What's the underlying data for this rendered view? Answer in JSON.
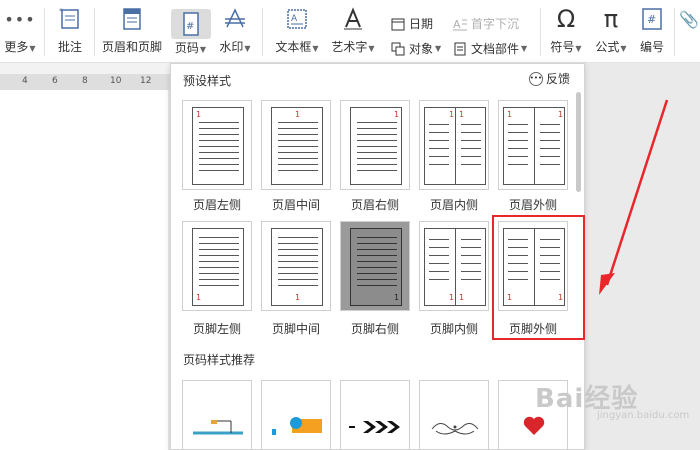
{
  "ribbon": {
    "more": "更多",
    "comment": "批注",
    "header_footer": "页眉和页脚",
    "page_number": "页码",
    "watermark": "水印",
    "textbox": "文本框",
    "wordart": "艺术字",
    "date": "日期",
    "object": "对象",
    "drop_cap": "首字下沉",
    "doc_parts": "文档部件",
    "symbol": "符号",
    "formula": "公式",
    "numbering": "编号"
  },
  "ruler": {
    "ticks": [
      "4",
      "6",
      "8",
      "10",
      "12"
    ]
  },
  "panel": {
    "title": "预设样式",
    "feedback": "反馈",
    "presets_row1": [
      {
        "label": "页眉左侧",
        "number": "1"
      },
      {
        "label": "页眉中间",
        "number": "1"
      },
      {
        "label": "页眉右侧",
        "number": "1"
      },
      {
        "label": "页眉内侧",
        "number": "1"
      },
      {
        "label": "页眉外侧",
        "number": "1"
      }
    ],
    "presets_row2": [
      {
        "label": "页脚左侧",
        "number": "1"
      },
      {
        "label": "页脚中间",
        "number": "1"
      },
      {
        "label": "页脚右侧",
        "number": "1"
      },
      {
        "label": "页脚内侧",
        "number": "1"
      },
      {
        "label": "页脚外侧",
        "number": "1"
      }
    ],
    "recommend_title": "页码样式推荐"
  },
  "watermark_site": {
    "text": "Bai经验",
    "sub": "jingyan.baidu.com"
  },
  "colors": {
    "highlight": "#e8272c",
    "page_number_red": "#c0392b",
    "selected_card": "#9a9a9a"
  },
  "icons": [
    "more-icon",
    "comment-icon",
    "header-footer-icon",
    "page-number-icon",
    "watermark-icon",
    "textbox-icon",
    "wordart-icon",
    "date-icon",
    "object-icon",
    "drop-cap-icon",
    "doc-parts-icon",
    "symbol-icon",
    "formula-icon",
    "numbering-icon",
    "paperclip-icon",
    "feedback-icon"
  ]
}
